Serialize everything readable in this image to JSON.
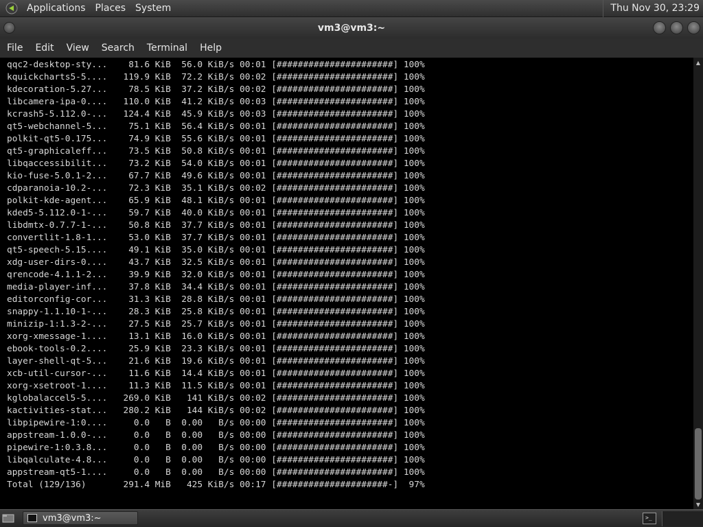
{
  "panel": {
    "menus": [
      "Applications",
      "Places",
      "System"
    ],
    "clock": "Thu Nov 30, 23:29"
  },
  "window": {
    "title": "vm3@vm3:~"
  },
  "menubar": {
    "items": [
      "File",
      "Edit",
      "View",
      "Search",
      "Terminal",
      "Help"
    ]
  },
  "terminal": {
    "lines": [
      "qqc2-desktop-sty...    81.6 KiB  56.0 KiB/s 00:01 [######################] 100%",
      "kquickcharts5-5....   119.9 KiB  72.2 KiB/s 00:02 [######################] 100%",
      "kdecoration-5.27...    78.5 KiB  37.2 KiB/s 00:02 [######################] 100%",
      "libcamera-ipa-0....   110.0 KiB  41.2 KiB/s 00:03 [######################] 100%",
      "kcrash5-5.112.0-...   124.4 KiB  45.9 KiB/s 00:03 [######################] 100%",
      "qt5-webchannel-5...    75.1 KiB  56.4 KiB/s 00:01 [######################] 100%",
      "polkit-qt5-0.175...    74.9 KiB  55.6 KiB/s 00:01 [######################] 100%",
      "qt5-graphicaleff...    73.5 KiB  50.8 KiB/s 00:01 [######################] 100%",
      "libqaccessibilit...    73.2 KiB  54.0 KiB/s 00:01 [######################] 100%",
      "kio-fuse-5.0.1-2...    67.7 KiB  49.6 KiB/s 00:01 [######################] 100%",
      "cdparanoia-10.2-...    72.3 KiB  35.1 KiB/s 00:02 [######################] 100%",
      "polkit-kde-agent...    65.9 KiB  48.1 KiB/s 00:01 [######################] 100%",
      "kded5-5.112.0-1-...    59.7 KiB  40.0 KiB/s 00:01 [######################] 100%",
      "libdmtx-0.7.7-1-...    50.8 KiB  37.7 KiB/s 00:01 [######################] 100%",
      "convertlit-1.8-1...    53.0 KiB  37.7 KiB/s 00:01 [######################] 100%",
      "qt5-speech-5.15....    49.1 KiB  35.0 KiB/s 00:01 [######################] 100%",
      "xdg-user-dirs-0....    43.7 KiB  32.5 KiB/s 00:01 [######################] 100%",
      "qrencode-4.1.1-2...    39.9 KiB  32.0 KiB/s 00:01 [######################] 100%",
      "media-player-inf...    37.8 KiB  34.4 KiB/s 00:01 [######################] 100%",
      "editorconfig-cor...    31.3 KiB  28.8 KiB/s 00:01 [######################] 100%",
      "snappy-1.1.10-1-...    28.3 KiB  25.8 KiB/s 00:01 [######################] 100%",
      "minizip-1:1.3-2-...    27.5 KiB  25.7 KiB/s 00:01 [######################] 100%",
      "xorg-xmessage-1....    13.1 KiB  16.0 KiB/s 00:01 [######################] 100%",
      "ebook-tools-0.2....    25.9 KiB  23.3 KiB/s 00:01 [######################] 100%",
      "layer-shell-qt-5...    21.6 KiB  19.6 KiB/s 00:01 [######################] 100%",
      "xcb-util-cursor-...    11.6 KiB  14.4 KiB/s 00:01 [######################] 100%",
      "xorg-xsetroot-1....    11.3 KiB  11.5 KiB/s 00:01 [######################] 100%",
      "kglobalaccel5-5....   269.0 KiB   141 KiB/s 00:02 [######################] 100%",
      "kactivities-stat...   280.2 KiB   144 KiB/s 00:02 [######################] 100%",
      "libpipewire-1:0....     0.0   B  0.00   B/s 00:00 [######################] 100%",
      "appstream-1.0.0-...     0.0   B  0.00   B/s 00:00 [######################] 100%",
      "pipewire-1:0.3.8...     0.0   B  0.00   B/s 00:00 [######################] 100%",
      "libqalculate-4.8...     0.0   B  0.00   B/s 00:00 [######################] 100%",
      "appstream-qt5-1....     0.0   B  0.00   B/s 00:00 [######################] 100%",
      "Total (129/136)       291.4 MiB   425 KiB/s 00:17 [#####################-]  97%"
    ]
  },
  "taskbar": {
    "task_label": "vm3@vm3:~"
  },
  "icons": {
    "panel_logo": "gnome-foot-icon",
    "window_menu": "window-menu-icon",
    "minimize": "minimize-icon",
    "maximize": "maximize-icon",
    "close": "close-icon",
    "show_desktop": "show-desktop-icon",
    "terminal": "terminal-icon"
  }
}
